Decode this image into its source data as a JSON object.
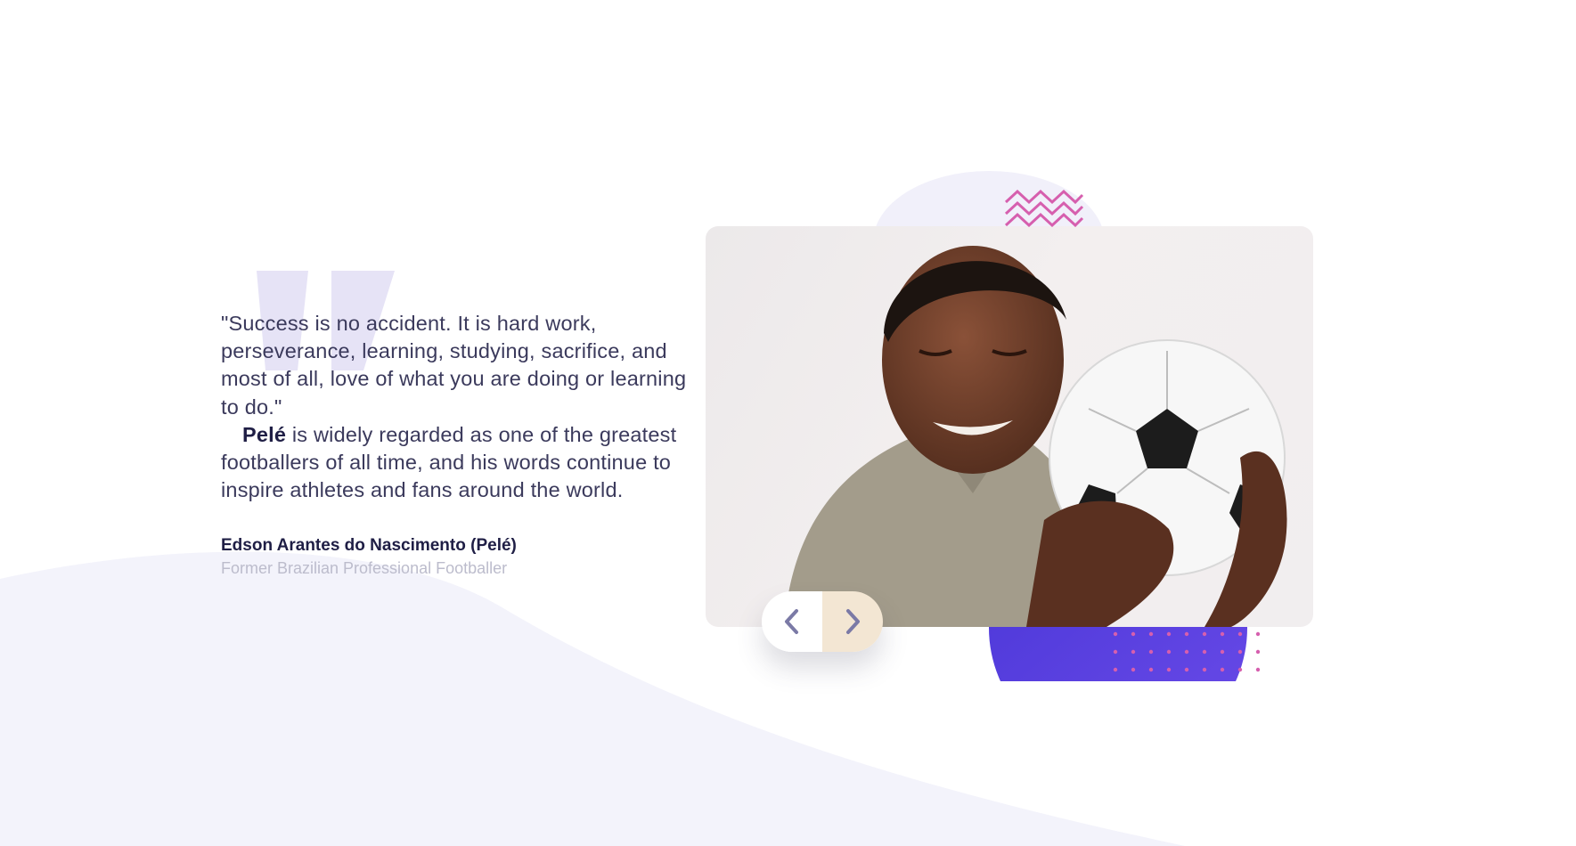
{
  "testimonial": {
    "quote_lines": [
      "\"Success is no accident. It is hard work,",
      "perseverance, learning, studying, sacrifice, and",
      "most of all, love of what you are doing or learning",
      "to do.\""
    ],
    "description_bold": "Pelé",
    "description_rest": " is widely regarded as one of the greatest footballers of all time, and his words continue to inspire athletes and fans around the world.",
    "author_name": "Edson Arantes do Nascimento (Pelé)",
    "author_role": "Former Brazilian Professional Footballer"
  },
  "slider": {
    "prev_icon": "chevron-left-icon",
    "next_icon": "chevron-right-icon"
  },
  "colors": {
    "text_primary": "#1f1e45",
    "text_body": "#3b3a5c",
    "text_muted": "#bcbccc",
    "quote_mark": "#e6e3f6",
    "wave_bg": "#f3f3fb",
    "accent_purple": "#5a3fe0",
    "accent_pink": "#d65fae",
    "next_button_bg": "#f3e6d3"
  }
}
